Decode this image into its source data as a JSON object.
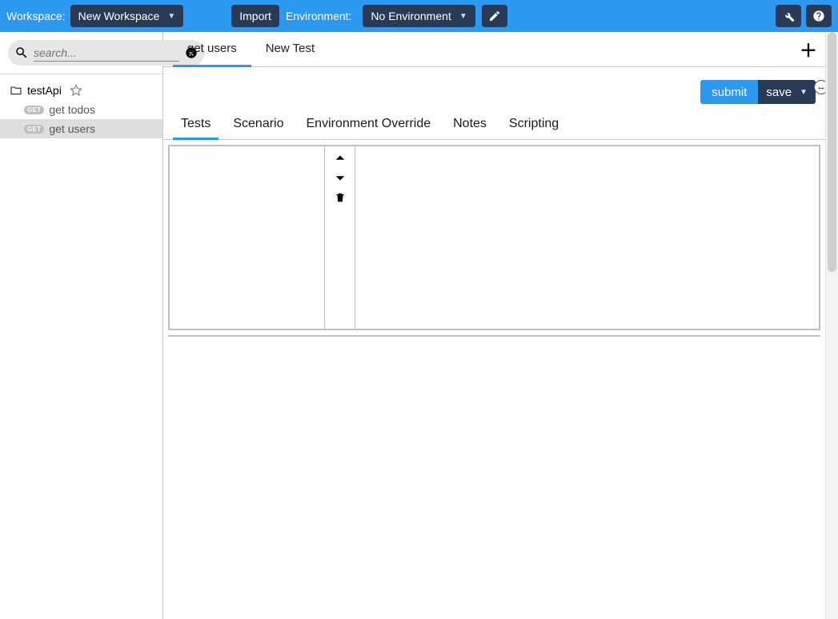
{
  "topbar": {
    "workspace_label": "Workspace:",
    "workspace_value": "New Workspace",
    "import_label": "Import",
    "environment_label": "Environment:",
    "environment_value": "No Environment"
  },
  "sidebar": {
    "search_placeholder": "search...",
    "folder": {
      "name": "testApi"
    },
    "items": [
      {
        "method": "GET",
        "name": "get todos",
        "selected": false
      },
      {
        "method": "GET",
        "name": "get users",
        "selected": true
      }
    ]
  },
  "tabs": [
    {
      "label": "get users",
      "active": true
    },
    {
      "label": "New Test",
      "active": false
    }
  ],
  "actions": {
    "submit_label": "submit",
    "save_label": "save"
  },
  "sub_tabs": [
    {
      "label": "Tests",
      "active": true
    },
    {
      "label": "Scenario",
      "active": false
    },
    {
      "label": "Environment Override",
      "active": false
    },
    {
      "label": "Notes",
      "active": false
    },
    {
      "label": "Scripting",
      "active": false
    }
  ]
}
